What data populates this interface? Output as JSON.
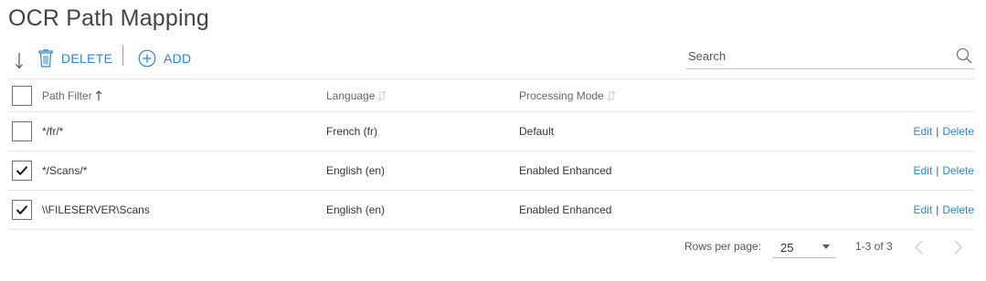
{
  "page": {
    "title": "OCR Path Mapping"
  },
  "toolbar": {
    "delete_label": "DELETE",
    "add_label": "ADD",
    "search_placeholder": "Search"
  },
  "table": {
    "headers": {
      "path_filter": "Path Filter",
      "language": "Language",
      "processing_mode": "Processing Mode"
    },
    "rows": [
      {
        "path_filter": "*/fr/*",
        "language": "French (fr)",
        "processing_mode": "Default",
        "checked": false,
        "edit_label": "Edit",
        "sep": "|",
        "delete_label": "Delete"
      },
      {
        "path_filter": "*/Scans/*",
        "language": "English (en)",
        "processing_mode": "Enabled Enhanced",
        "checked": true,
        "edit_label": "Edit",
        "sep": "|",
        "delete_label": "Delete"
      },
      {
        "path_filter": "\\\\FILESERVER\\Scans",
        "language": "English (en)",
        "processing_mode": "Enabled Enhanced",
        "checked": true,
        "edit_label": "Edit",
        "sep": "|",
        "delete_label": "Delete"
      }
    ]
  },
  "pagination": {
    "rows_per_page_label": "Rows per page:",
    "rows_per_page_value": "25",
    "range_text": "1-3 of 3"
  },
  "colors": {
    "accent": "#2e86c9",
    "border": "#e3e3e3",
    "text": "#333333"
  },
  "icons": {
    "sort": "sort-arrow-icon",
    "delete": "trash-icon",
    "add": "plus-circle-icon",
    "search": "search-icon",
    "checked": "checkmark-icon",
    "prev": "chevron-left-icon",
    "next": "chevron-right-icon"
  }
}
